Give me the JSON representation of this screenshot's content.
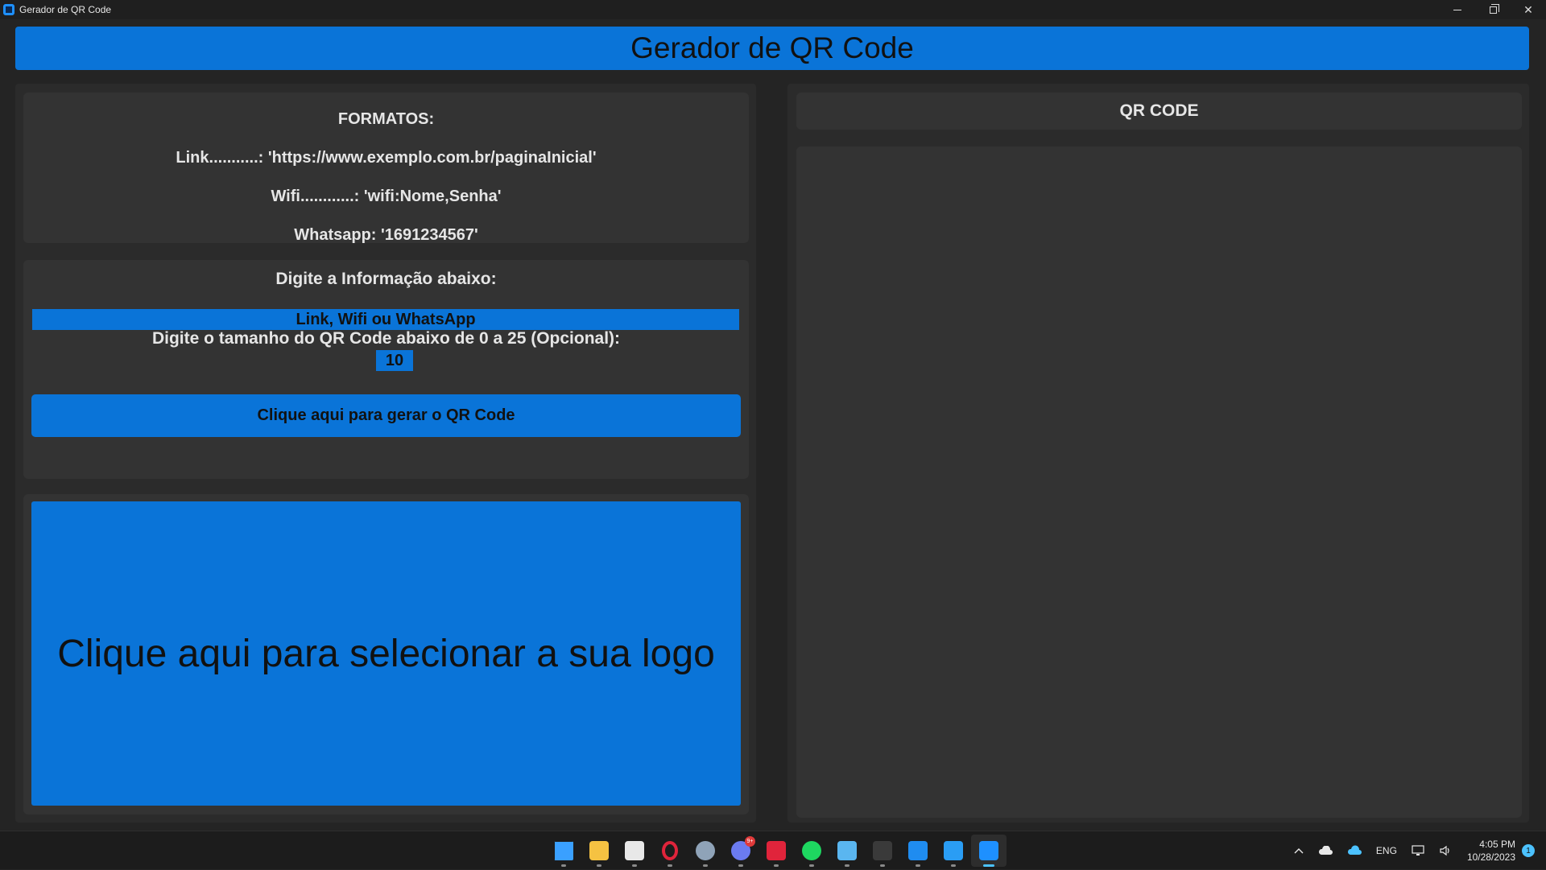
{
  "window": {
    "title": "Gerador de QR Code"
  },
  "header": {
    "title": "Gerador de QR Code"
  },
  "formats": {
    "heading": "FORMATOS:",
    "link": "Link...........: 'https://www.exemplo.com.br/paginaInicial'",
    "wifi": "Wifi............: 'wifi:Nome,Senha'",
    "whatsapp": "Whatsapp: '1691234567'"
  },
  "input_section": {
    "info_label": "Digite a Informação abaixo:",
    "info_placeholder": "Link, Wifi ou WhatsApp",
    "size_label": "Digite o tamanho do QR Code abaixo de 0 a 25 (Opcional):",
    "size_value": "10",
    "generate_button": "Clique aqui para gerar o QR Code"
  },
  "logo_section": {
    "button_label": "Clique aqui para selecionar a sua logo"
  },
  "qr_section": {
    "heading": "QR CODE"
  },
  "taskbar": {
    "apps": [
      {
        "name": "start-icon",
        "color": "#3aa0ff"
      },
      {
        "name": "file-explorer-icon",
        "color": "#f5c242"
      },
      {
        "name": "store-icon",
        "color": "#e8e8e8"
      },
      {
        "name": "opera-icon",
        "color": "#e0243b"
      },
      {
        "name": "settings-icon",
        "color": "#8fa3b8"
      },
      {
        "name": "discord-icon",
        "color": "#6b7bf0",
        "badge": "9+"
      },
      {
        "name": "adobe-icon",
        "color": "#e0243b"
      },
      {
        "name": "spotify-icon",
        "color": "#1ed760"
      },
      {
        "name": "remote-desktop-icon",
        "color": "#5ab6f0"
      },
      {
        "name": "terminal-icon",
        "color": "#3a3a3a"
      },
      {
        "name": "defender-icon",
        "color": "#1f8cf0"
      },
      {
        "name": "vscode-icon",
        "color": "#2a9df4"
      },
      {
        "name": "qr-app-icon",
        "color": "#1e90ff",
        "active": true
      }
    ],
    "tray": {
      "language": "ENG",
      "time": "4:05 PM",
      "date": "10/28/2023",
      "notifications": "1"
    }
  }
}
